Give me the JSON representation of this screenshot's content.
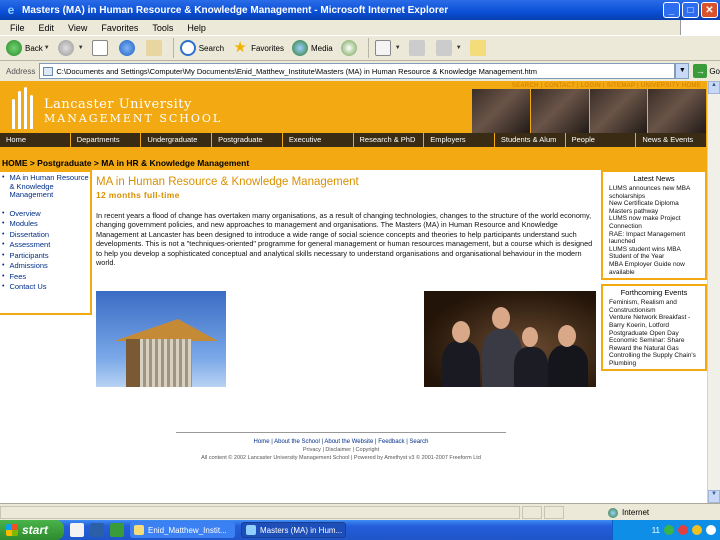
{
  "window": {
    "title": "Masters (MA) in Human Resource & Knowledge Management - Microsoft Internet Explorer",
    "minimize": "_",
    "maximize": "□",
    "close": "✕"
  },
  "menu": [
    "File",
    "Edit",
    "View",
    "Favorites",
    "Tools",
    "Help"
  ],
  "toolbar": {
    "back": "Back",
    "search": "Search",
    "favorites": "Favorites",
    "media": "Media"
  },
  "address": {
    "label": "Address",
    "value": "C:\\Documents and Settings\\Computer\\My Documents\\Enid_Matthew_Institute\\Masters (MA) in Human Resource & Knowledge Management.htm",
    "go": "Go"
  },
  "site": {
    "toplinks": "SEARCH | CONTACT | LOGIN | SITEMAP | UNIVERSITY HOME",
    "university": "Lancaster University",
    "school": "MANAGEMENT SCHOOL",
    "nav": [
      "Home",
      "Departments",
      "Undergraduate",
      "Postgraduate",
      "Executive",
      "Research & PhD",
      "Employers",
      "Students & Alum",
      "People",
      "News & Events"
    ],
    "breadcrumb": "HOME > Postgraduate > MA in HR & Knowledge Management",
    "leftnav_top": [
      "MA in Human Resource & Knowledge Management"
    ],
    "leftnav": [
      "Overview",
      "Modules",
      "Dissertation",
      "Assessment",
      "Participants",
      "Admissions",
      "Fees",
      "Contact Us"
    ],
    "page_title": "MA in Human Resource & Knowledge Management",
    "page_subtitle": "12 months full-time",
    "body": "In recent years a flood of change has overtaken many organisations, as a result of changing technologies, changes to the structure of the world economy, changing government policies, and new approaches to management and organisations. The Masters (MA) in Human Resource and Knowledge Management at Lancaster has been designed to introduce a wide range of social science concepts and theories to help participants understand such developments. This is not a \"techniques-oriented\" programme for general management or human resources management, but a course which is designed to help you develop a sophisticated conceptual and analytical skills necessary to understand organisations and organisational behaviour in the modern world.",
    "latest_news": {
      "heading": "Latest News",
      "items": [
        "LUMS announces new MBA scholarships",
        "New Certificate Diploma Masters pathway",
        "LUMS now make Project Connection",
        "RAE: Impact Management launched",
        "LUMS student wins MBA Student of the Year",
        "MBA Employer Guide now available"
      ]
    },
    "events": {
      "heading": "Forthcoming Events",
      "items": [
        "Feminism, Realism and Constructionism",
        "Venture Network Breakfast - Barry Koerin, Lotford",
        "Postgraduate Open Day",
        "Economic Seminar: Share Reward the Natural Gas",
        "Controlling the Supply Chain's Plumbing"
      ]
    },
    "footer": {
      "links": "Home | About the School | About the Website | Feedback | Search",
      "links2": "Privacy | Disclaimer | Copyright",
      "small": "All content © 2002 Lancaster University Management School | Powered by Amethyst v3 © 2001-2007 Freeform Ltd"
    }
  },
  "status": {
    "zone": "Internet"
  },
  "taskbar": {
    "start": "start",
    "tasks": [
      "Enid_Matthew_Instit...",
      "Masters (MA) in Hum..."
    ],
    "clock": "11"
  }
}
